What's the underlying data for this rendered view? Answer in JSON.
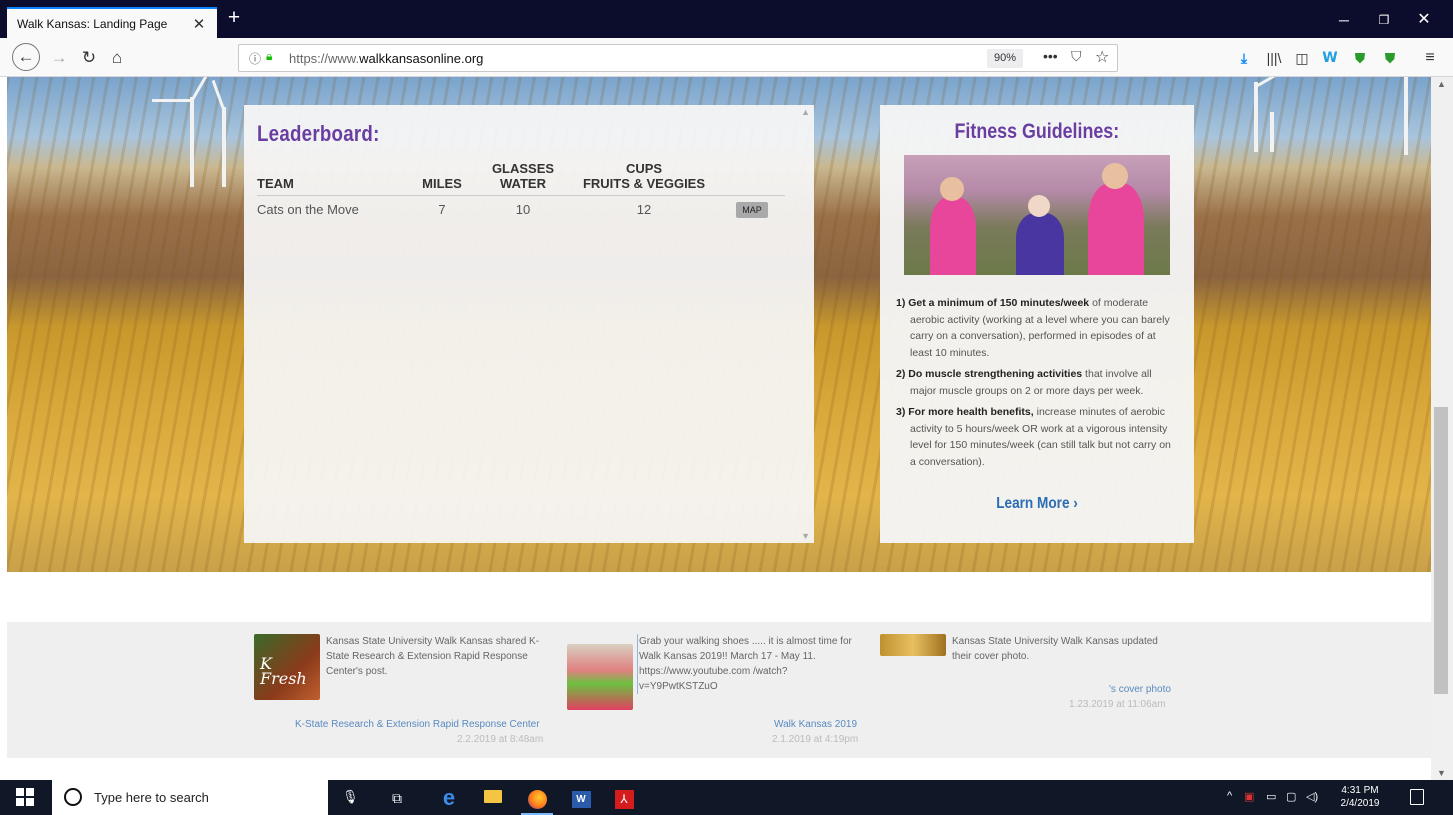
{
  "browser": {
    "tab_title": "Walk Kansas: Landing Page",
    "tab_close": "✕",
    "new_tab": "+",
    "url_prefix": "https://www.",
    "url_domain": "walkkansasonline.org",
    "zoom": "90%",
    "window_min": "─",
    "window_max": "❐",
    "window_close": "✕"
  },
  "leaderboard": {
    "title": "Leaderboard:",
    "columns": {
      "team": "TEAM",
      "miles": "MILES",
      "glasses_1": "GLASSES",
      "glasses_2": "WATER",
      "cups_1": "CUPS",
      "cups_2": "FRUITS & VEGGIES"
    },
    "rows": [
      {
        "team": "Cats on the Move",
        "miles": "7",
        "water": "10",
        "cups": "12",
        "action": "MAP"
      }
    ]
  },
  "fitness": {
    "title": "Fitness Guidelines:",
    "items": [
      {
        "bold": "1) Get a minimum of 150 minutes/week",
        "text": " of moderate aerobic activity (working at a level where you can barely carry on a conversation), performed in episodes of at least 10 minutes."
      },
      {
        "bold": "2) Do muscle strengthening activities",
        "text": " that involve all major muscle groups on 2 or more days per week."
      },
      {
        "bold": "3) For more health benefits,",
        "text": " increase minutes of aerobic activity to 5 hours/week OR work at a vigorous intensity level for 150 minutes/week (can still talk but not carry on a conversation)."
      }
    ],
    "learn_more": "Learn More ›"
  },
  "feed": [
    {
      "text": "Kansas State University Walk Kansas shared K-State Research & Extension Rapid Response Center's post.",
      "thumb_label": "K Fresh",
      "link": "K-State Research & Extension Rapid Response Center",
      "time": "2.2.2019 at 8:48am"
    },
    {
      "text": "Grab your walking shoes ..... it is almost time for Walk Kansas 2019!! March 17 - May 11. https://www.youtube.com /watch?v=Y9PwtKSTZuO",
      "link": "Walk Kansas 2019",
      "time": "2.1.2019 at 4:19pm"
    },
    {
      "text": "Kansas State University Walk Kansas updated their cover photo.",
      "link": "'s cover photo",
      "time": "1.23.2019 at 11:06am"
    }
  ],
  "taskbar": {
    "search_placeholder": "Type here to search",
    "time": "4:31 PM",
    "date": "2/4/2019"
  }
}
